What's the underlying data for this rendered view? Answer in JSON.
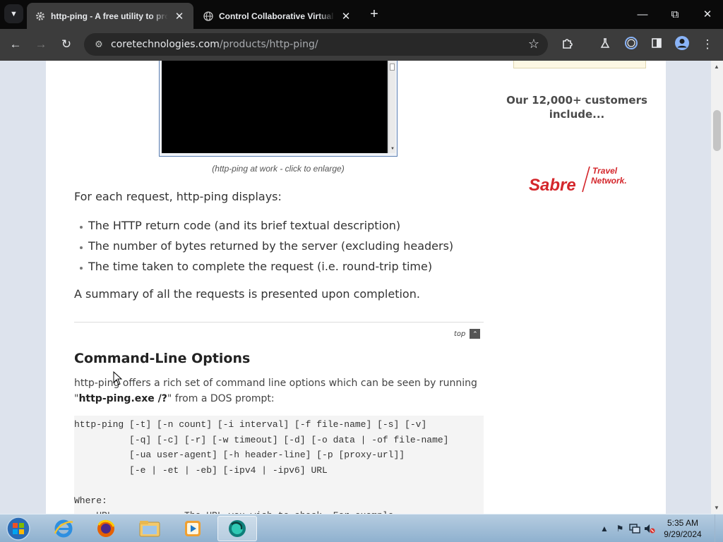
{
  "browser": {
    "tabs": [
      {
        "title": "http-ping - A free utility to probe",
        "active": true
      },
      {
        "title": "Control Collaborative Virtual M",
        "active": false
      }
    ],
    "url_domain": "coretechnologies.com",
    "url_path": "/products/http-ping/"
  },
  "page": {
    "screenshot_caption": "(http-ping at work - click to enlarge)",
    "displays_intro": "For each request, http-ping displays:",
    "bullets": [
      "The HTTP return code (and its brief textual description)",
      "The number of bytes returned by the server (excluding headers)",
      "The time taken to complete the request (i.e. round-trip time)"
    ],
    "summary": "A summary of all the requests is presented upon completion.",
    "top_link": "top",
    "section_heading": "Command-Line Options",
    "intro_text": "http-ping offers a rich set of command line options which can be seen by running",
    "intro_quote_open": "\"",
    "intro_command": "http-ping.exe /?",
    "intro_quote_close": "\" from a DOS prompt:",
    "code_lines": [
      "http-ping [-t] [-n count] [-i interval] [-f file-name] [-s] [-v]",
      "          [-q] [-c] [-r] [-w timeout] [-d] [-o data | -of file-name]",
      "          [-ua user-agent] [-h header-line] [-p [proxy-url]]",
      "          [-e | -et | -eb] [-ipv4 | -ipv6] URL",
      "",
      "Where:",
      "    URL             The URL you wish to check. For example"
    ]
  },
  "sidebar": {
    "customers_line1": "Our 12,000+ customers",
    "customers_line2": "include...",
    "logo_text": "Sabre",
    "logo_sub1": "Travel",
    "logo_sub2": "Network."
  },
  "taskbar": {
    "time": "5:35 AM",
    "date": "9/29/2024"
  },
  "colors": {
    "sabre_red": "#d4262b",
    "chrome_dark": "#3c3c3c"
  }
}
